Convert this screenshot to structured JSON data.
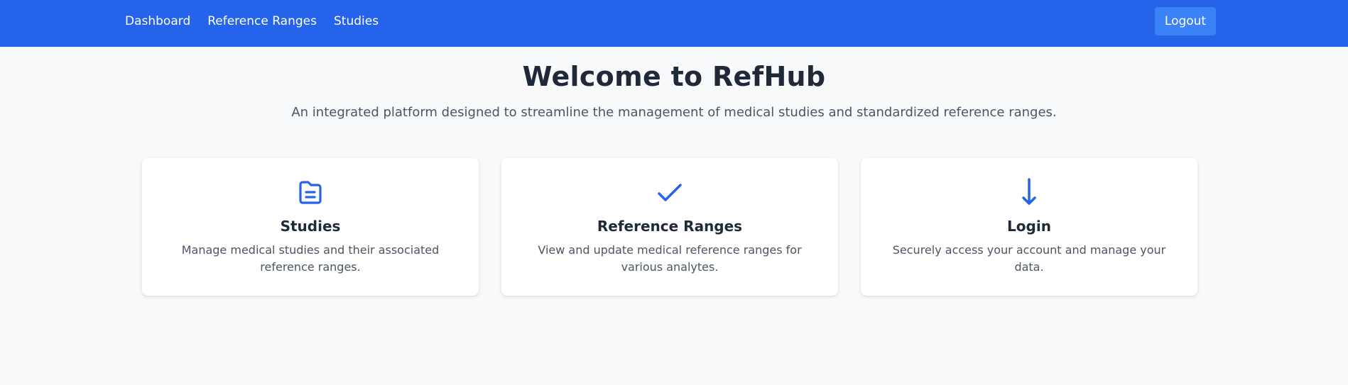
{
  "nav": {
    "links": [
      "Dashboard",
      "Reference Ranges",
      "Studies"
    ],
    "logout_label": "Logout",
    "color": "#2563eb"
  },
  "hero": {
    "title": "Welcome to RefHub",
    "subtitle": "An integrated platform designed to streamline the management of medical studies and standardized reference ranges."
  },
  "cards": [
    {
      "icon": "document-icon",
      "title": "Studies",
      "description": "Manage medical studies and their associated reference ranges."
    },
    {
      "icon": "check-icon",
      "title": "Reference Ranges",
      "description": "View and update medical reference ranges for various analytes."
    },
    {
      "icon": "arrow-down-icon",
      "title": "Login",
      "description": "Securely access your account and manage your data."
    }
  ],
  "accent_color": "#2563eb"
}
